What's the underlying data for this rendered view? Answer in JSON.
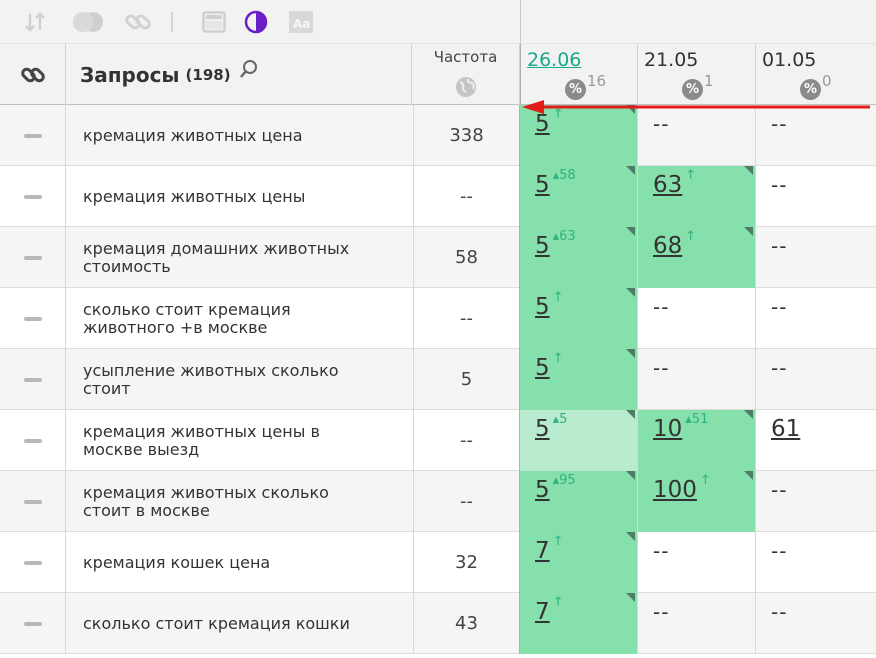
{
  "toolbar": {
    "icons": [
      "sort-icon",
      "circles-icon",
      "link-icon",
      "window-icon",
      "contrast-icon",
      "font-icon"
    ]
  },
  "header": {
    "title": "Запросы",
    "count": "(198)",
    "freq_label": "Частота",
    "dates": [
      {
        "label": "26.06",
        "pct_sup": "16"
      },
      {
        "label": "21.05",
        "pct_sup": "1"
      },
      {
        "label": "01.05",
        "pct_sup": "0"
      }
    ],
    "pct_symbol": "%"
  },
  "colors": {
    "green": "#86e0ac",
    "light_green": "#b9ecce",
    "accent": "#1aaa8a",
    "arrow": "#e21b1b"
  },
  "rows": [
    {
      "query": "кремация животных цена",
      "freq": "338",
      "pos": [
        {
          "v": "5",
          "ch": "↑",
          "c": "green"
        },
        {
          "v": "--",
          "ch": "",
          "c": "none"
        },
        {
          "v": "--",
          "ch": "",
          "c": "none"
        }
      ]
    },
    {
      "query": "кремация животных цены",
      "freq": "--",
      "pos": [
        {
          "v": "5",
          "ch": "▴58",
          "c": "green"
        },
        {
          "v": "63",
          "ch": "↑",
          "c": "green"
        },
        {
          "v": "--",
          "ch": "",
          "c": "none"
        }
      ]
    },
    {
      "query": "кремация домашних животных стоимость",
      "freq": "58",
      "pos": [
        {
          "v": "5",
          "ch": "▴63",
          "c": "green"
        },
        {
          "v": "68",
          "ch": "↑",
          "c": "green"
        },
        {
          "v": "--",
          "ch": "",
          "c": "none"
        }
      ]
    },
    {
      "query": "сколько стоит кремация животного +в москве",
      "freq": "--",
      "pos": [
        {
          "v": "5",
          "ch": "↑",
          "c": "green"
        },
        {
          "v": "--",
          "ch": "",
          "c": "none"
        },
        {
          "v": "--",
          "ch": "",
          "c": "none"
        }
      ]
    },
    {
      "query": "усыпление животных сколько стоит",
      "freq": "5",
      "pos": [
        {
          "v": "5",
          "ch": "↑",
          "c": "green"
        },
        {
          "v": "--",
          "ch": "",
          "c": "none"
        },
        {
          "v": "--",
          "ch": "",
          "c": "none"
        }
      ]
    },
    {
      "query": "кремация животных цены в москве выезд",
      "freq": "--",
      "pos": [
        {
          "v": "5",
          "ch": "▴5",
          "c": "lgreen"
        },
        {
          "v": "10",
          "ch": "▴51",
          "c": "green"
        },
        {
          "v": "61",
          "ch": "",
          "c": "none"
        }
      ]
    },
    {
      "query": "кремация животных сколько стоит в москве",
      "freq": "--",
      "pos": [
        {
          "v": "5",
          "ch": "▴95",
          "c": "green"
        },
        {
          "v": "100",
          "ch": "↑",
          "c": "green"
        },
        {
          "v": "--",
          "ch": "",
          "c": "none"
        }
      ]
    },
    {
      "query": "кремация кошек цена",
      "freq": "32",
      "pos": [
        {
          "v": "7",
          "ch": "↑",
          "c": "green"
        },
        {
          "v": "--",
          "ch": "",
          "c": "none"
        },
        {
          "v": "--",
          "ch": "",
          "c": "none"
        }
      ]
    },
    {
      "query": "сколько стоит кремация кошки",
      "freq": "43",
      "pos": [
        {
          "v": "7",
          "ch": "↑",
          "c": "green"
        },
        {
          "v": "--",
          "ch": "",
          "c": "none"
        },
        {
          "v": "--",
          "ch": "",
          "c": "none"
        }
      ]
    }
  ]
}
